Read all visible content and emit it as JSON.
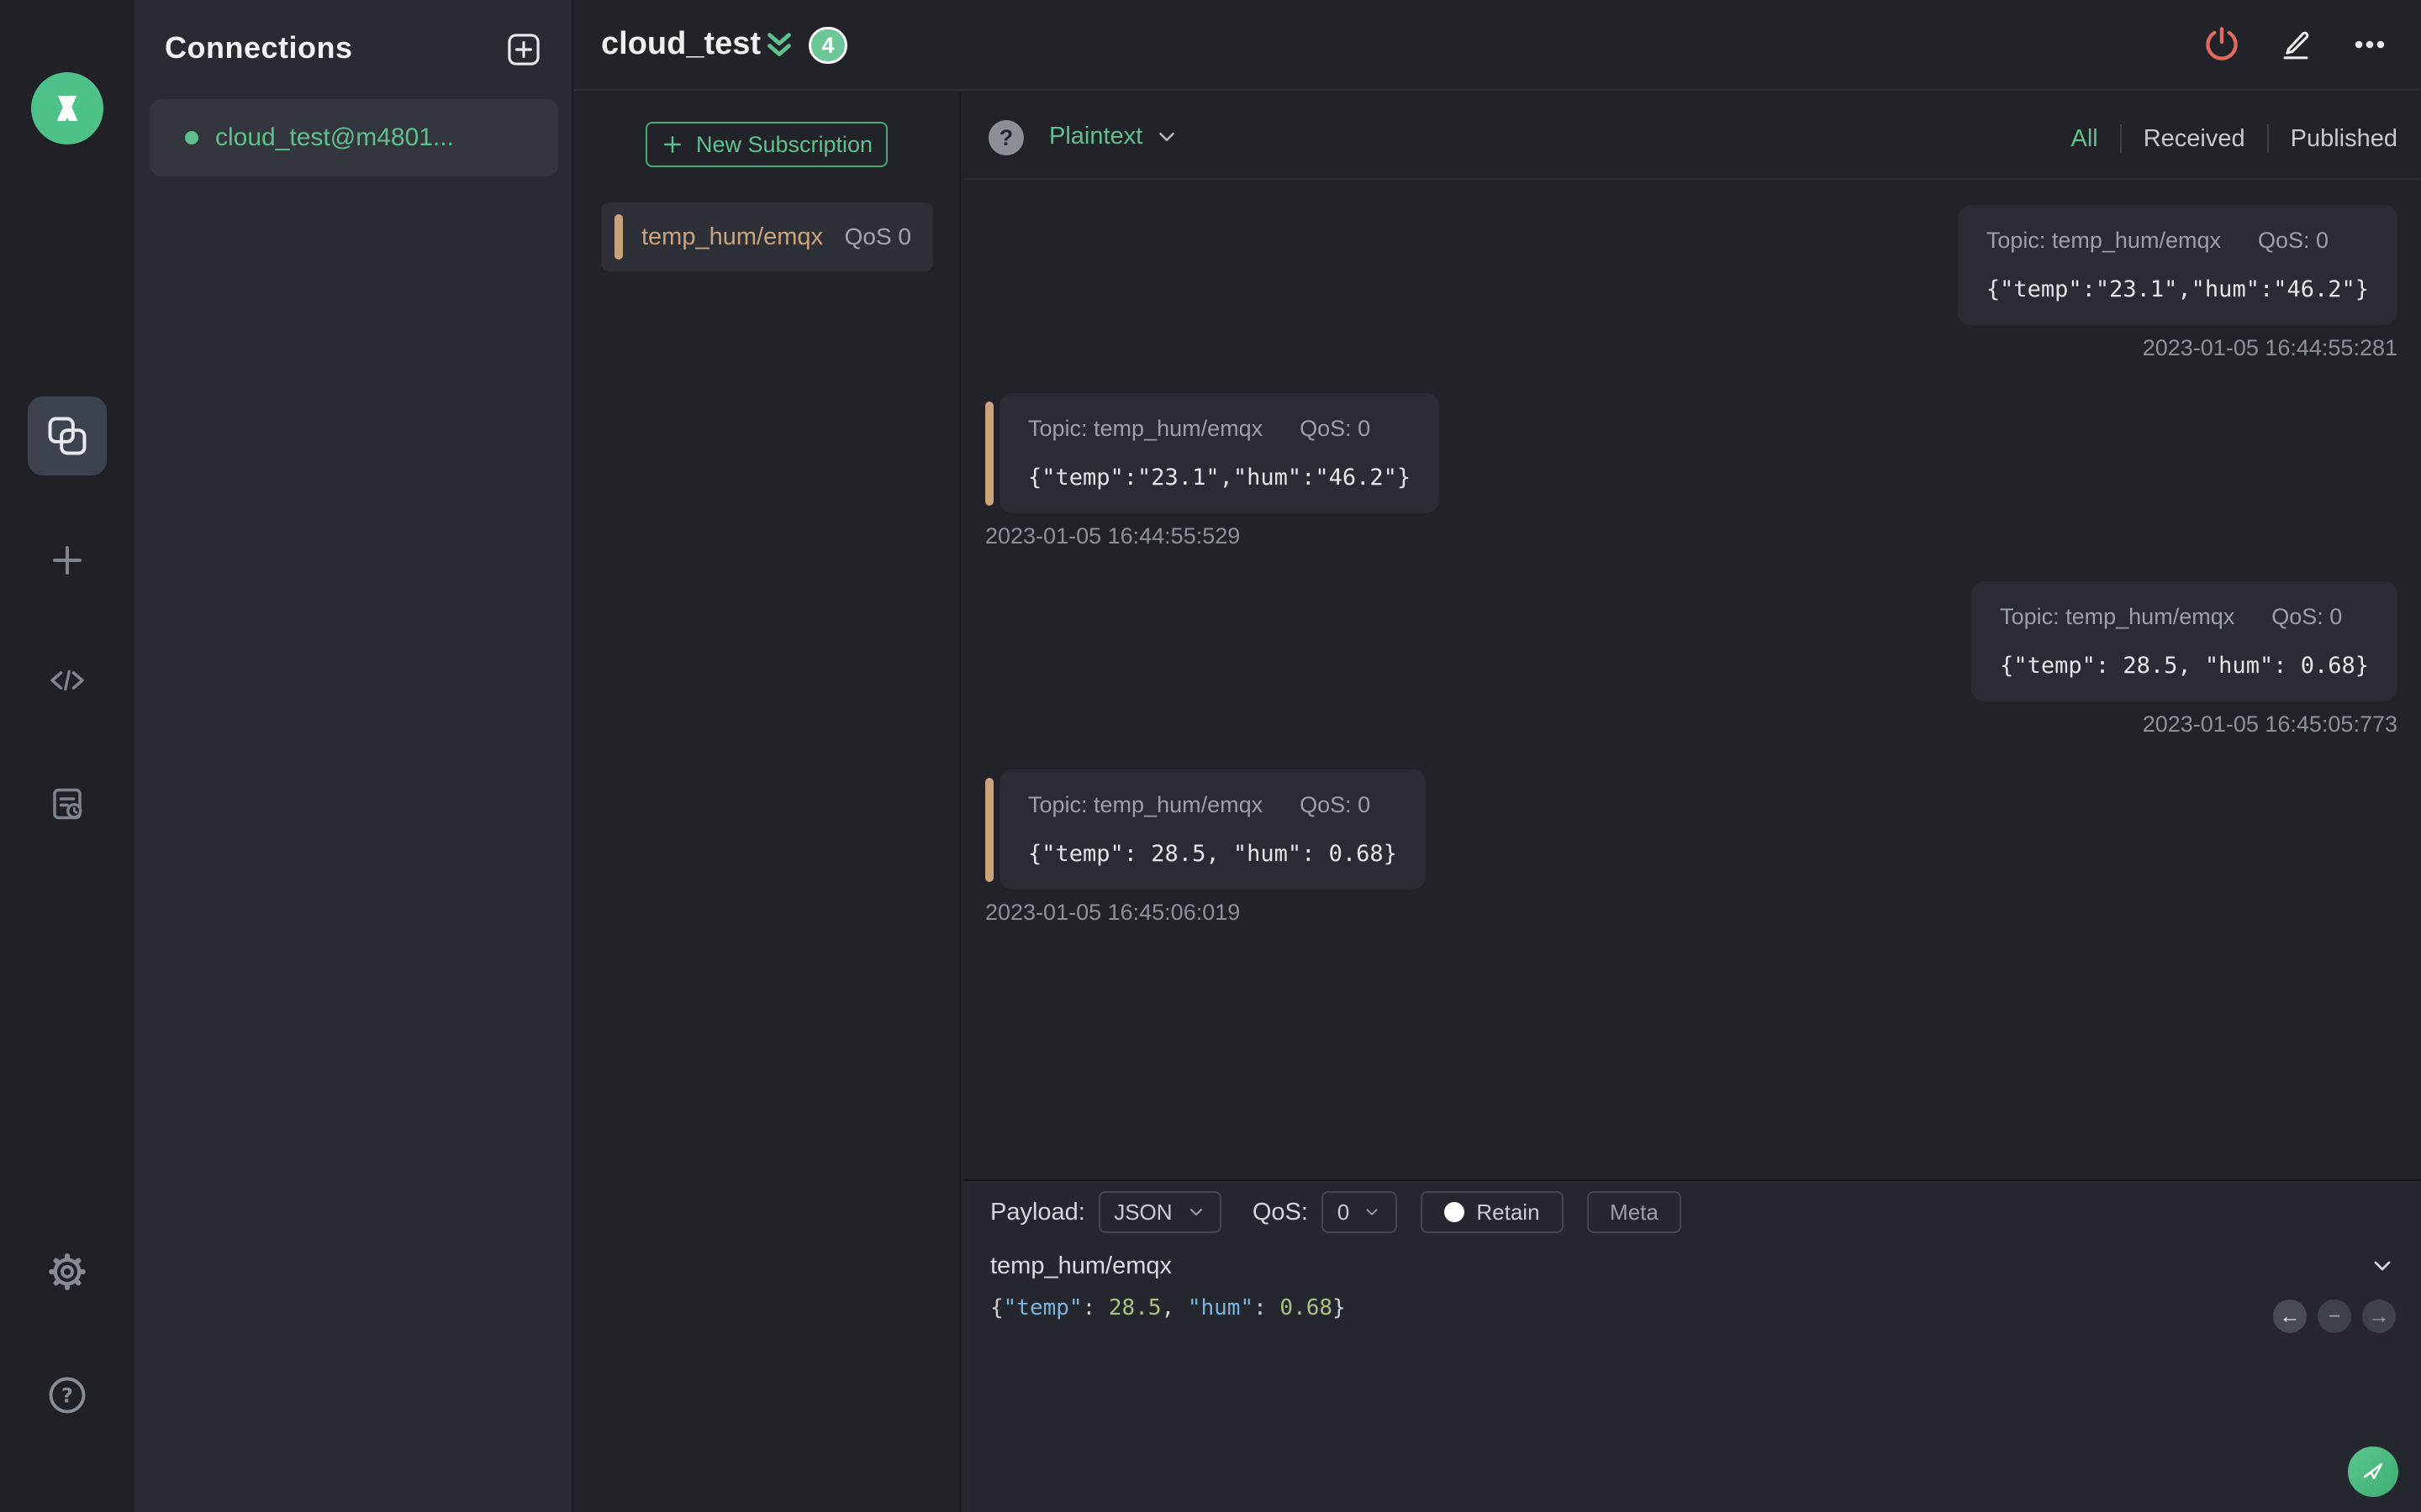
{
  "colors": {
    "accent_green": "#5fc08d",
    "accent_tan": "#cba47b",
    "disconnect_red": "#e0685f",
    "syntax_key_blue": "#7ab3dc",
    "syntax_num_green": "#a8c383"
  },
  "iconbar": {
    "logo": "mqttx-logo",
    "items": [
      "connections",
      "new-connection",
      "script",
      "log",
      "settings",
      "help"
    ]
  },
  "connections": {
    "title": "Connections",
    "items": [
      {
        "name": "cloud_test@m4801...",
        "connected": true
      }
    ]
  },
  "header": {
    "title": "cloud_test",
    "badge_count": "4"
  },
  "subscriptions": {
    "new_button_label": "New Subscription",
    "items": [
      {
        "topic": "temp_hum/emqx",
        "qos": "QoS 0"
      }
    ]
  },
  "messages": {
    "format_selected": "Plaintext",
    "filters": [
      {
        "label": "All",
        "active": true
      },
      {
        "label": "Received",
        "active": false
      },
      {
        "label": "Published",
        "active": false
      }
    ],
    "items": [
      {
        "direction": "published",
        "topic_label": "Topic: temp_hum/emqx",
        "qos_label": "QoS: 0",
        "payload": "{\"temp\":\"23.1\",\"hum\":\"46.2\"}",
        "timestamp": "2023-01-05 16:44:55:281"
      },
      {
        "direction": "received",
        "topic_label": "Topic: temp_hum/emqx",
        "qos_label": "QoS: 0",
        "payload": "{\"temp\":\"23.1\",\"hum\":\"46.2\"}",
        "timestamp": "2023-01-05 16:44:55:529"
      },
      {
        "direction": "published",
        "topic_label": "Topic: temp_hum/emqx",
        "qos_label": "QoS: 0",
        "payload": "{\"temp\": 28.5, \"hum\": 0.68}",
        "timestamp": "2023-01-05 16:45:05:773"
      },
      {
        "direction": "received",
        "topic_label": "Topic: temp_hum/emqx",
        "qos_label": "QoS: 0",
        "payload": "{\"temp\": 28.5, \"hum\": 0.68}",
        "timestamp": "2023-01-05 16:45:06:019"
      }
    ]
  },
  "publish": {
    "payload_label": "Payload:",
    "payload_format": "JSON",
    "qos_label": "QoS:",
    "qos_value": "0",
    "retain_label": "Retain",
    "meta_label": "Meta",
    "topic_value": "temp_hum/emqx",
    "payload_tokens": [
      {
        "text": "{",
        "type": "punc"
      },
      {
        "text": "\"temp\"",
        "type": "key"
      },
      {
        "text": ": ",
        "type": "punc"
      },
      {
        "text": "28.5",
        "type": "num"
      },
      {
        "text": ", ",
        "type": "punc"
      },
      {
        "text": "\"hum\"",
        "type": "key"
      },
      {
        "text": ": ",
        "type": "punc"
      },
      {
        "text": "0.68",
        "type": "num"
      },
      {
        "text": "}",
        "type": "punc"
      }
    ]
  }
}
